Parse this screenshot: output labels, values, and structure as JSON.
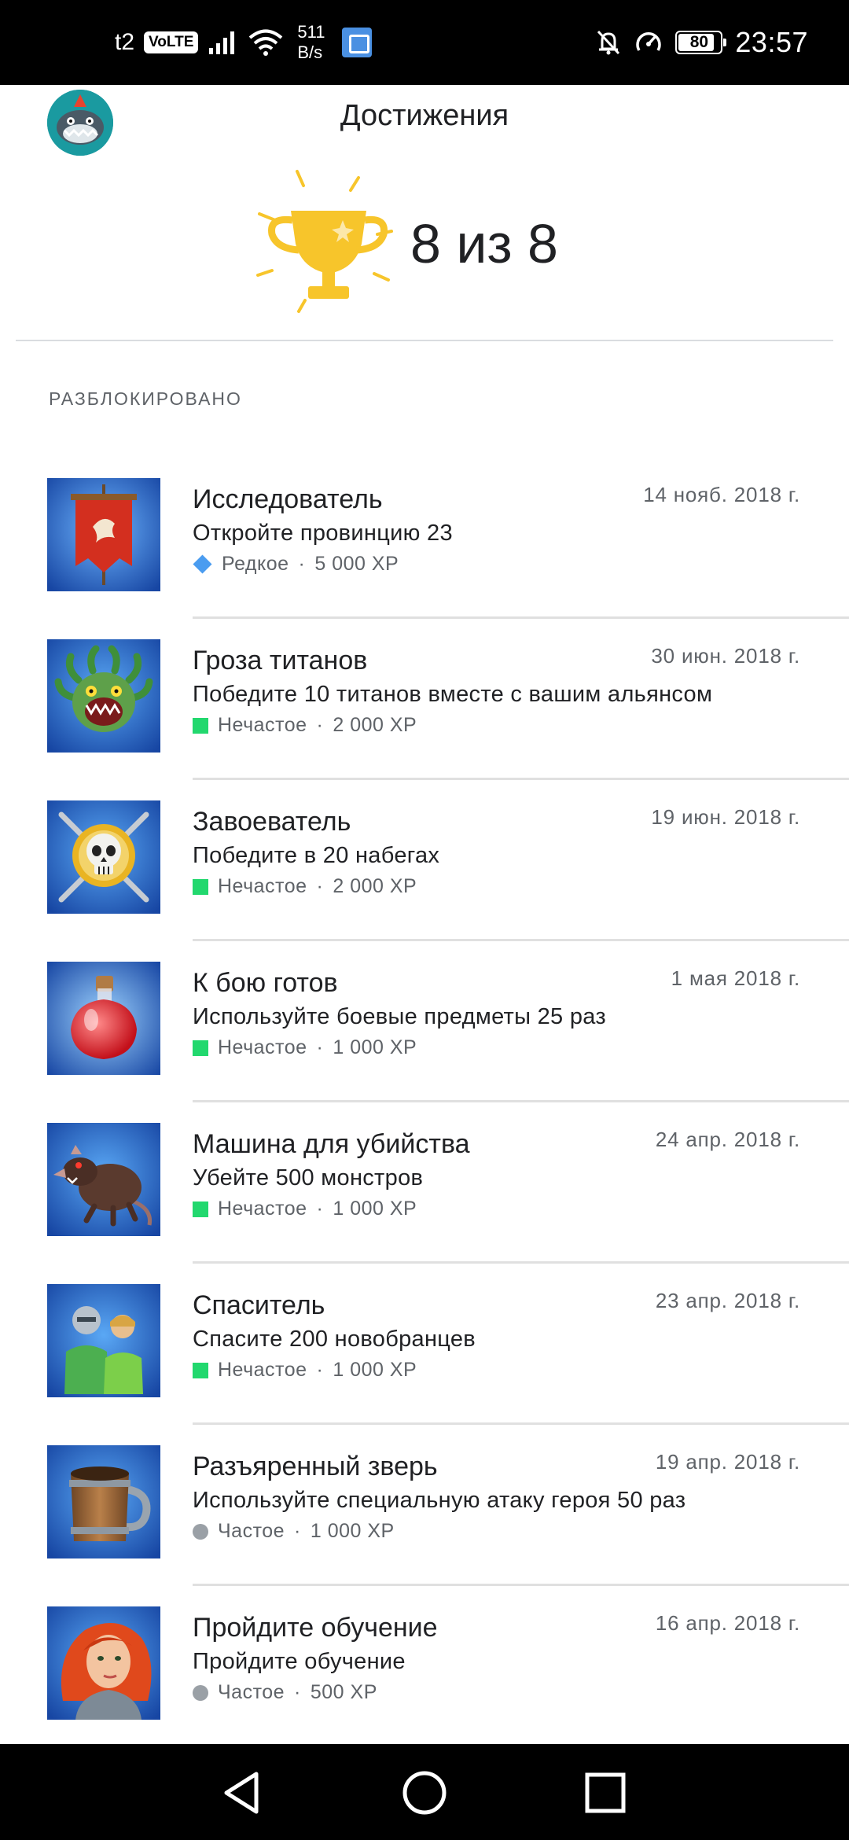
{
  "status_bar": {
    "carrier": "t2",
    "volte": "VoLTE",
    "net_speed_value": "511",
    "net_speed_unit": "B/s",
    "battery": "80",
    "time": "23:57"
  },
  "header": {
    "title": "Достижения",
    "summary": "8 из 8"
  },
  "section_label": "РАЗБЛОКИРОВАНО",
  "achievements": [
    {
      "title": "Исследователь",
      "description": "Откройте провинцию 23",
      "rarity": "Редкое",
      "xp": "5 000 XP",
      "date": "14 нояб. 2018 г.",
      "rarity_type": "rare",
      "icon": "banner-icon"
    },
    {
      "title": "Гроза титанов",
      "description": "Победите 10 титанов вместе с вашим альянсом",
      "rarity": "Нечастое",
      "xp": "2 000 XP",
      "date": "30 июн. 2018 г.",
      "rarity_type": "uncommon",
      "icon": "medusa-icon"
    },
    {
      "title": "Завоеватель",
      "description": "Победите в 20 набегах",
      "rarity": "Нечастое",
      "xp": "2 000 XP",
      "date": "19 июн. 2018 г.",
      "rarity_type": "uncommon",
      "icon": "skull-swords-icon"
    },
    {
      "title": "К бою готов",
      "description": "Используйте боевые предметы 25 раз",
      "rarity": "Нечастое",
      "xp": "1 000 XP",
      "date": "1 мая 2018 г.",
      "rarity_type": "uncommon",
      "icon": "potion-icon"
    },
    {
      "title": "Машина для убийства",
      "description": "Убейте 500 монстров",
      "rarity": "Нечастое",
      "xp": "1 000 XP",
      "date": "24 апр. 2018 г.",
      "rarity_type": "uncommon",
      "icon": "rat-monster-icon"
    },
    {
      "title": "Спаситель",
      "description": "Спасите 200 новобранцев",
      "rarity": "Нечастое",
      "xp": "1 000 XP",
      "date": "23 апр. 2018 г.",
      "rarity_type": "uncommon",
      "icon": "recruits-icon"
    },
    {
      "title": "Разъяренный зверь",
      "description": "Используйте специальную атаку героя 50 раз",
      "rarity": "Частое",
      "xp": "1 000 XP",
      "date": "19 апр. 2018 г.",
      "rarity_type": "common",
      "icon": "mug-icon"
    },
    {
      "title": "Пройдите обучение",
      "description": "Пройдите обучение",
      "rarity": "Частое",
      "xp": "500 XP",
      "date": "16 апр. 2018 г.",
      "rarity_type": "common",
      "icon": "heroine-icon"
    }
  ],
  "meta_separator": "·",
  "colors": {
    "rare": "#4a9cf0",
    "uncommon": "#22d86e",
    "common": "#9aa0a6",
    "trophy": "#f7c52b",
    "icon_bg": "#1f5fb4"
  }
}
